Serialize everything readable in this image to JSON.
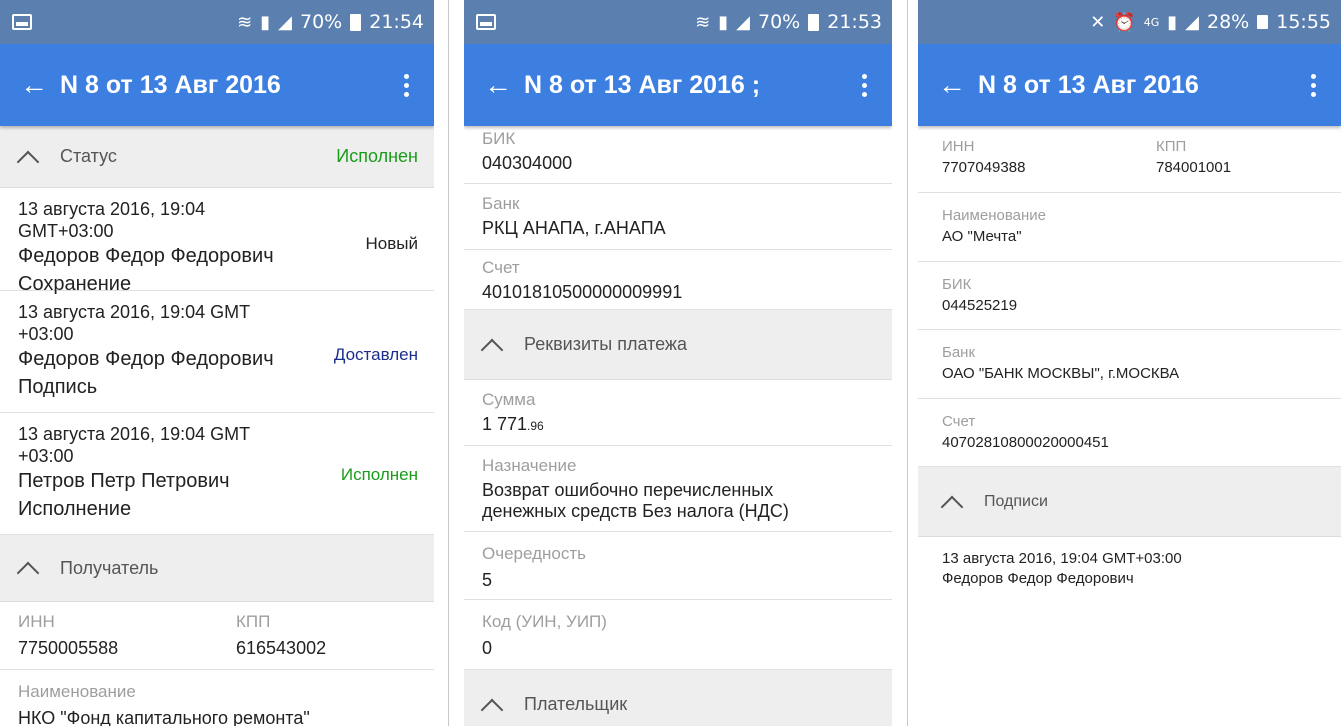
{
  "colors": {
    "statusbar": "#5b80b0",
    "appbar": "#3d7fe0",
    "section_bg": "#eeeeee",
    "status_green": "#1a9b1a",
    "status_navy": "#1b2d8f"
  },
  "screen1": {
    "statusbar": {
      "battery": "70%",
      "time": "21:54"
    },
    "appbar": {
      "title": "N 8 от 13 Авг 2016"
    },
    "status_section": {
      "label": "Статус",
      "value": "Исполнен"
    },
    "history": [
      {
        "date": "13 августа 2016, 19:04 GMT+03:00",
        "name": "Федоров Федор Федорович",
        "action": "Сохранение",
        "status": "Новый"
      },
      {
        "date": "13 августа 2016, 19:04 GMT +03:00",
        "name": "Федоров Федор Федорович",
        "action": "Подпись",
        "status": "Доставлен"
      },
      {
        "date": "13 августа 2016, 19:04 GMT +03:00",
        "name": "Петров Петр Петрович",
        "action": "Исполнение",
        "status": "Исполнен"
      }
    ],
    "recipient_section": {
      "label": "Получатель"
    },
    "inn": {
      "label": "ИНН",
      "value": "7750005588"
    },
    "kpp": {
      "label": "КПП",
      "value": "616543002"
    },
    "name": {
      "label": "Наименование",
      "value": "НКО \"Фонд капитального ремонта\""
    }
  },
  "screen2": {
    "statusbar": {
      "battery": "70%",
      "time": "21:53"
    },
    "appbar": {
      "title": "N 8 от 13 Авг 2016 ;"
    },
    "bik": {
      "label": "БИК",
      "value": "040304000"
    },
    "bank": {
      "label": "Банк",
      "value": "РКЦ АНАПА, г.АНАПА"
    },
    "account": {
      "label": "Счет",
      "value": "40101810500000009991"
    },
    "payment_section": {
      "label": "Реквизиты платежа"
    },
    "amount": {
      "label": "Сумма",
      "value_main": "1 771",
      "value_cents": ".96"
    },
    "purpose": {
      "label": "Назначение",
      "value_line1": "Возврат ошибочно перечисленных",
      "value_line2": "денежных средств Без налога (НДС)"
    },
    "priority": {
      "label": "Очередность",
      "value": "5"
    },
    "code": {
      "label": "Код (УИН, УИП)",
      "value": "0"
    },
    "payer_section": {
      "label": "Плательщик"
    }
  },
  "screen3": {
    "statusbar": {
      "battery": "28%",
      "time": "15:55",
      "network": "4G"
    },
    "appbar": {
      "title": "N 8 от 13 Авг 2016"
    },
    "inn": {
      "label": "ИНН",
      "value": "7707049388"
    },
    "kpp": {
      "label": "КПП",
      "value": "784001001"
    },
    "name": {
      "label": "Наименование",
      "value": "АО \"Мечта\""
    },
    "bik": {
      "label": "БИК",
      "value": "044525219"
    },
    "bank": {
      "label": "Банк",
      "value": "ОАО \"БАНК МОСКВЫ\", г.МОСКВА"
    },
    "account": {
      "label": "Счет",
      "value": "40702810800020000451"
    },
    "signatures_section": {
      "label": "Подписи"
    },
    "signature": {
      "date": "13 августа 2016, 19:04 GMT+03:00",
      "name": "Федоров Федор Федорович"
    }
  }
}
